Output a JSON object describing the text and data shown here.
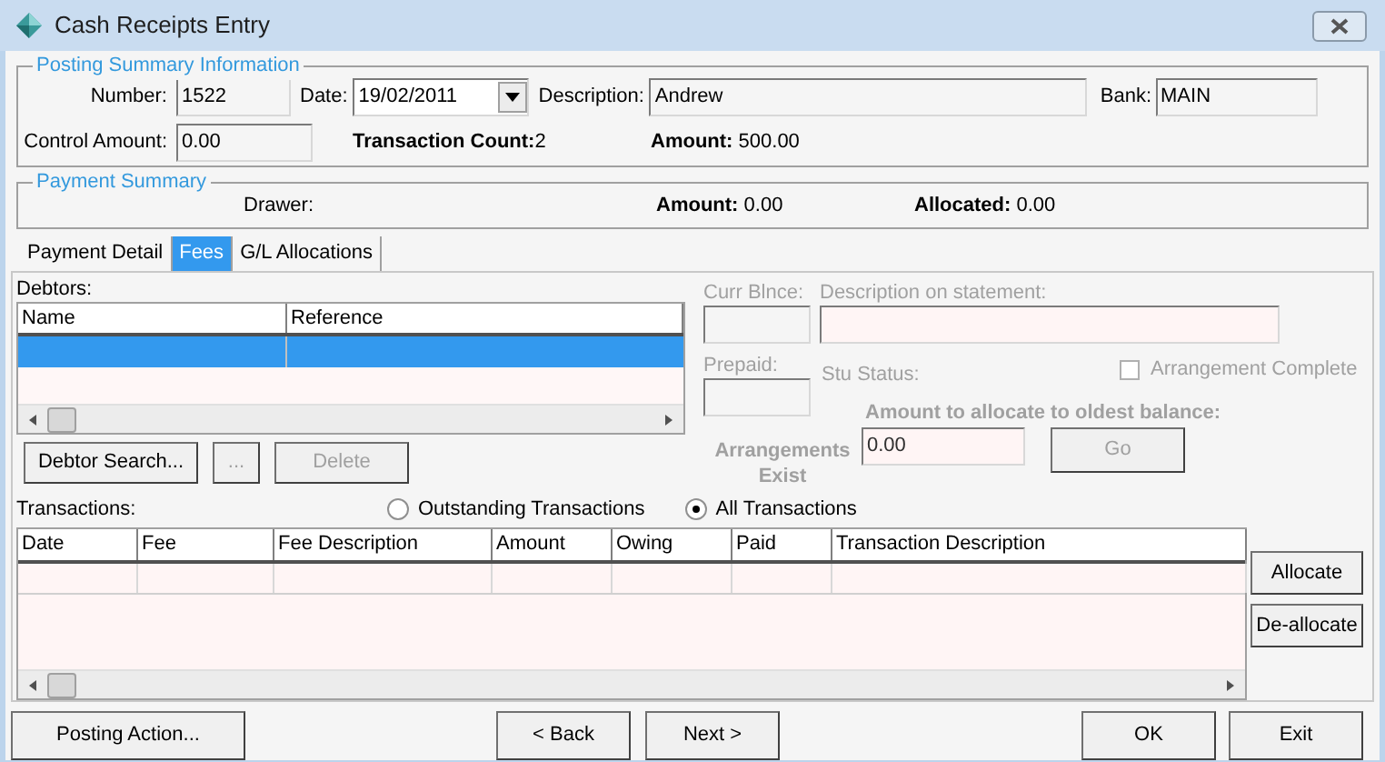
{
  "window": {
    "title": "Cash Receipts Entry"
  },
  "posting_summary": {
    "title": "Posting Summary Information",
    "number": {
      "label": "Number:",
      "value": "1522"
    },
    "date": {
      "label": "Date:",
      "value": "19/02/2011"
    },
    "description": {
      "label": "Description:",
      "value": "Andrew"
    },
    "bank": {
      "label": "Bank:",
      "value": "MAIN"
    },
    "control_amount": {
      "label": "Control Amount:",
      "value": "0.00"
    },
    "transaction_count": {
      "label": "Transaction Count:",
      "value": "2"
    },
    "amount": {
      "label": "Amount:",
      "value": "500.00"
    }
  },
  "payment_summary": {
    "title": "Payment Summary",
    "drawer": {
      "label": "Drawer:"
    },
    "amount": {
      "label": "Amount:",
      "value": "0.00"
    },
    "allocated": {
      "label": "Allocated:",
      "value": "0.00"
    }
  },
  "tabs": [
    {
      "label": "Payment Detail",
      "selected": false
    },
    {
      "label": "Fees",
      "selected": true
    },
    {
      "label": "G/L Allocations",
      "selected": false
    }
  ],
  "debtors": {
    "label": "Debtors:",
    "columns": [
      "Name",
      "Reference"
    ],
    "rows": [
      {
        "selected": true
      }
    ]
  },
  "debtor_buttons": [
    {
      "label": "Debtor Search...",
      "disabled": false
    },
    {
      "label": "...",
      "disabled": true
    },
    {
      "label": "Delete",
      "disabled": true
    }
  ],
  "details": {
    "disabled": true,
    "curr_balance": {
      "label": "Curr Blnce:"
    },
    "description_on_statement": {
      "label": "Description on statement:"
    },
    "prepaid": {
      "label": "Prepaid:"
    },
    "stu_status": {
      "label": "Stu Status:"
    },
    "arrangement_complete": {
      "label": "Arrangement Complete",
      "checked": false
    },
    "amount_to_allocate": {
      "label": "Amount to allocate to oldest balance:",
      "value": "0.00"
    },
    "arrangements_exist": {
      "label": "Arrangements Exist"
    },
    "go_button": {
      "label": "Go"
    }
  },
  "transactions": {
    "label": "Transactions:",
    "filters": [
      {
        "label": "Outstanding Transactions",
        "selected": false
      },
      {
        "label": "All Transactions",
        "selected": true
      }
    ],
    "columns": [
      "Date",
      "Fee",
      "Fee Description",
      "Amount",
      "Owing",
      "Paid",
      "Transaction Description"
    ]
  },
  "side_buttons": [
    "Allocate",
    "De-allocate"
  ],
  "footer_buttons": [
    "Posting Action...",
    "< Back",
    "Next >",
    "OK",
    "Exit"
  ]
}
